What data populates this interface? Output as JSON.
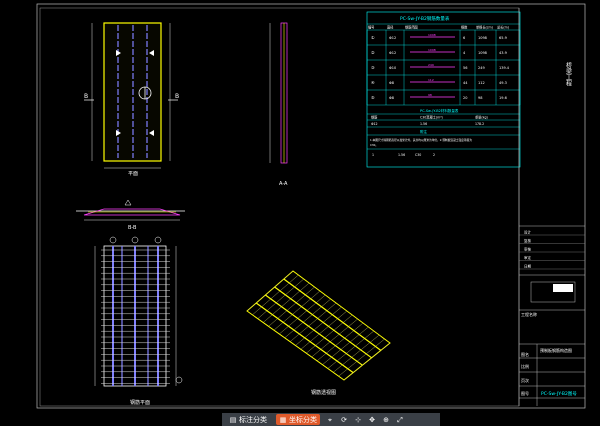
{
  "title_block": {
    "vertical_title": "桥梁工程",
    "project_name_label": "工程名称",
    "rows": [
      {
        "label": "设计",
        "value": ""
      },
      {
        "label": "复核",
        "value": ""
      },
      {
        "label": "审核",
        "value": ""
      },
      {
        "label": "审定",
        "value": ""
      },
      {
        "label": "日期",
        "value": ""
      }
    ],
    "drawing_title_label": "图名",
    "drawing_title": "预制板钢筋构造图",
    "drawing_no_label": "图号",
    "drawing_no": "PC-Sw-JY-B2图号",
    "scale_label": "比例",
    "sheet_label": "页次"
  },
  "table": {
    "title": "PC-Sw-JY-B2钢筋数量表",
    "headers": [
      "编号",
      "直径",
      "钢筋简图",
      "根数",
      "单根长(cm)",
      "总长(m)"
    ],
    "rows": [
      {
        "id": "①",
        "dia": "Φ12",
        "len": "1098",
        "n": "6",
        "total": "65.9"
      },
      {
        "id": "②",
        "dia": "Φ12",
        "len": "1098",
        "n": "4",
        "total": "43.9"
      },
      {
        "id": "③",
        "dia": "Φ10",
        "len": "249",
        "n": "56",
        "total": "139.4"
      },
      {
        "id": "④",
        "dia": "Φ8",
        "len": "112",
        "n": "44",
        "total": "49.3"
      },
      {
        "id": "⑤",
        "dia": "Φ8",
        "len": "98",
        "n": "20",
        "total": "19.6"
      }
    ],
    "sub_title": "PC-Sw-JY-B2材料数量表",
    "sub_headers": [
      "钢筋",
      "C30混凝土(m³)",
      "重量(kg)"
    ],
    "sub_values": [
      "Φ12",
      "1.56",
      "178.2"
    ],
    "note_title": "附注",
    "note_text": "1.本图尺寸除钢筋直径以毫米计外，其余均以厘米为单位。2.预制板混凝土强度等级为C30。",
    "note_row": [
      "1",
      "1.56",
      "C30",
      "2"
    ]
  },
  "labels": {
    "plan_view": "平面",
    "section_a": "A-A",
    "section_b": "B-B",
    "rebar_plan": "钢筋平面",
    "iso_view": "钢筋透视图",
    "section_letter_a": "A",
    "section_letter_b": "B"
  },
  "statusbar": {
    "btn1": "标注分类",
    "btn2": "坐标分类"
  },
  "colors": {
    "frame": "#ffffff",
    "table_line": "#00ffff",
    "rebar": "#ffff00",
    "accent": "#e05a2b",
    "bar_blue": "#8080ff",
    "hatch": "#ff40ff"
  }
}
